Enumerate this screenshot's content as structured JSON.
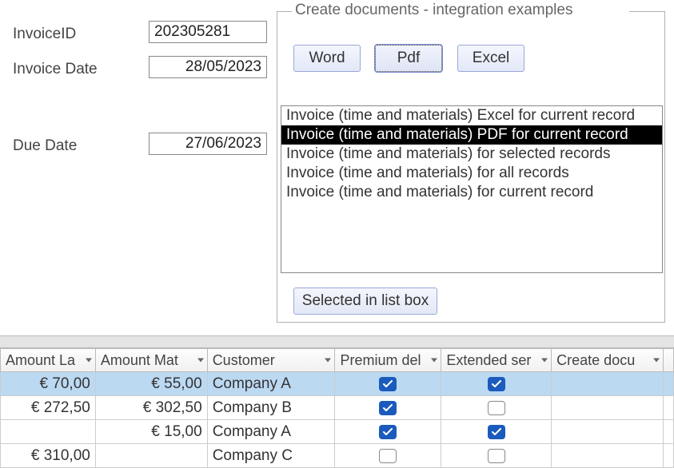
{
  "fields": {
    "invoice_id_label": "InvoiceID",
    "invoice_id_value": "202305281",
    "invoice_date_label": "Invoice Date",
    "invoice_date_value": "28/05/2023",
    "due_date_label": "Due Date",
    "due_date_value": "27/06/2023"
  },
  "panel": {
    "legend": "Create documents - integration examples",
    "buttons": {
      "word": "Word",
      "pdf": "Pdf",
      "excel": "Excel"
    },
    "list": [
      "Invoice (time and materials) Excel for current record",
      "Invoice (time and materials) PDF for current record",
      "Invoice (time and materials) for selected records",
      "Invoice (time and materials) for all records",
      "Invoice (time and materials) for current record"
    ],
    "list_selected_index": 1,
    "selected_btn": "Selected in list box"
  },
  "grid": {
    "headers": [
      "Amount La",
      "Amount Mat",
      "Customer",
      "Premium del",
      "Extended ser",
      "Create docu"
    ],
    "rows": [
      {
        "amount_la": "€ 70,00",
        "amount_mat": "€ 55,00",
        "customer": "Company A",
        "premium": true,
        "extended": true,
        "selected": true
      },
      {
        "amount_la": "€ 272,50",
        "amount_mat": "€ 302,50",
        "customer": "Company B",
        "premium": true,
        "extended": false,
        "selected": false
      },
      {
        "amount_la": "",
        "amount_mat": "€ 15,00",
        "customer": "Company A",
        "premium": true,
        "extended": true,
        "selected": false
      },
      {
        "amount_la": "€ 310,00",
        "amount_mat": "",
        "customer": "Company C",
        "premium": false,
        "extended": false,
        "selected": false
      }
    ]
  }
}
